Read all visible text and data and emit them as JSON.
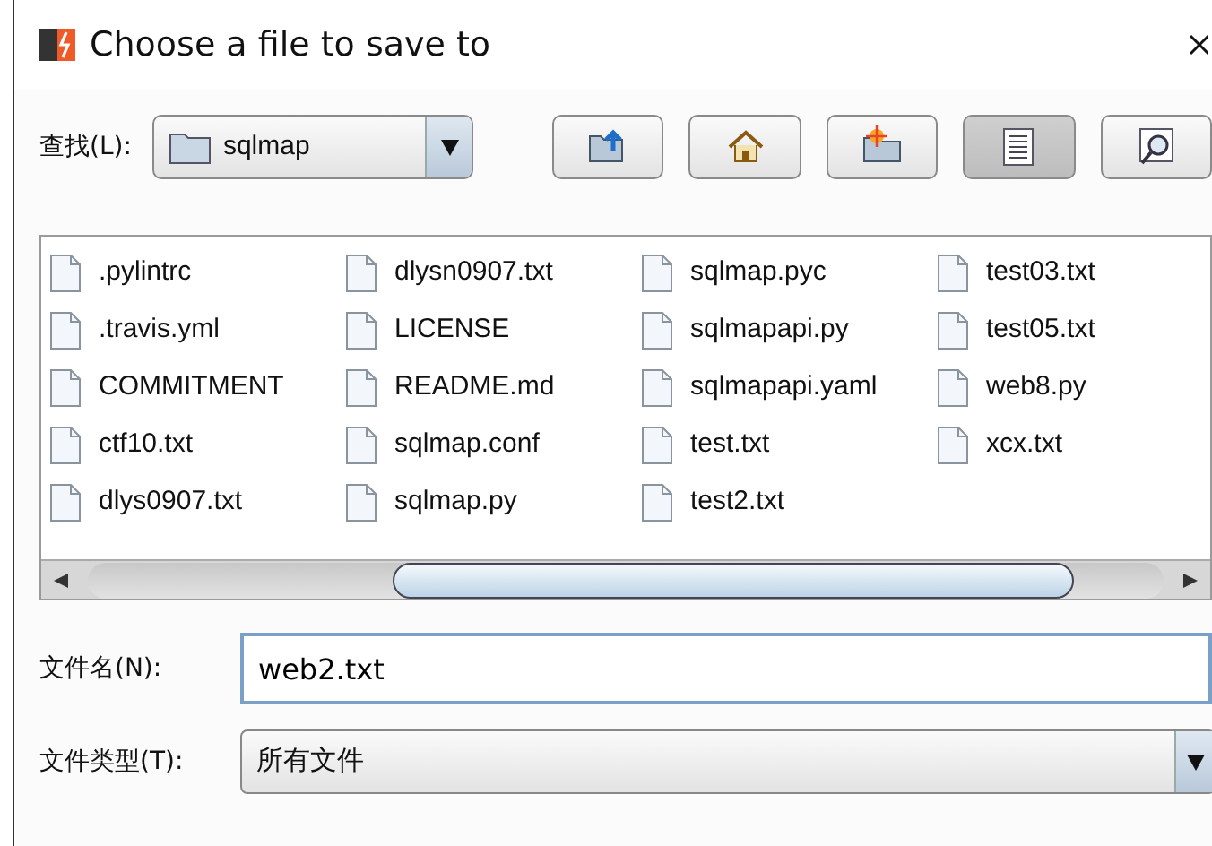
{
  "window": {
    "title": "Choose a file to save to"
  },
  "look_in": {
    "label": "查找(L):",
    "value": "sqlmap"
  },
  "toolbar": [
    {
      "kind": "up",
      "selected": false
    },
    {
      "kind": "home",
      "selected": false
    },
    {
      "kind": "new-folder",
      "selected": false
    },
    {
      "kind": "list",
      "selected": true
    },
    {
      "kind": "details",
      "selected": false
    }
  ],
  "files": [
    ".pylintrc",
    ".travis.yml",
    "COMMITMENT",
    "ctf10.txt",
    "dlys0907.txt",
    "dlysn0907.txt",
    "LICENSE",
    "README.md",
    "sqlmap.conf",
    "sqlmap.py",
    "sqlmap.pyc",
    "sqlmapapi.py",
    "sqlmapapi.yaml",
    "test.txt",
    "test2.txt",
    "test03.txt",
    "test05.txt",
    "web8.py",
    "xcx.txt"
  ],
  "file_name": {
    "label": "文件名(N):",
    "value": "web2.txt"
  },
  "file_type": {
    "label": "文件类型(T):",
    "value": "所有文件"
  }
}
